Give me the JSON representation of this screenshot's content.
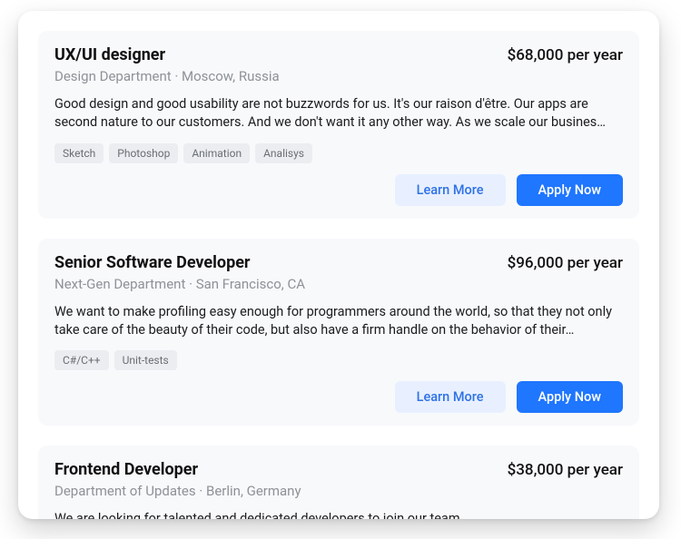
{
  "buttons": {
    "learn_more": "Learn More",
    "apply_now": "Apply Now"
  },
  "jobs": [
    {
      "title": "UX/UI designer",
      "salary": "$68,000 per year",
      "subtitle": "Design Department · Moscow, Russia",
      "description": "Good design and good usability are not buzzwords for us. It's our raison d'être. Our apps are second nature to our customers. And we don't want it any other way. As we scale our busines…",
      "tags": [
        "Sketch",
        "Photoshop",
        "Animation",
        "Analisys"
      ]
    },
    {
      "title": "Senior Software Developer",
      "salary": "$96,000 per year",
      "subtitle": "Next-Gen Department · San Francisco, CA",
      "description": "We want to make profiling easy enough for programmers around the world, so that they not only take care of the beauty of their code, but also have a firm handle on the behavior of their…",
      "tags": [
        "C#/C++",
        "Unit-tests"
      ]
    },
    {
      "title": "Frontend Developer",
      "salary": "$38,000 per year",
      "subtitle": "Department of Updates · Berlin, Germany",
      "description": "We are looking for talented and dedicated developers to join our team.",
      "tags": []
    }
  ]
}
